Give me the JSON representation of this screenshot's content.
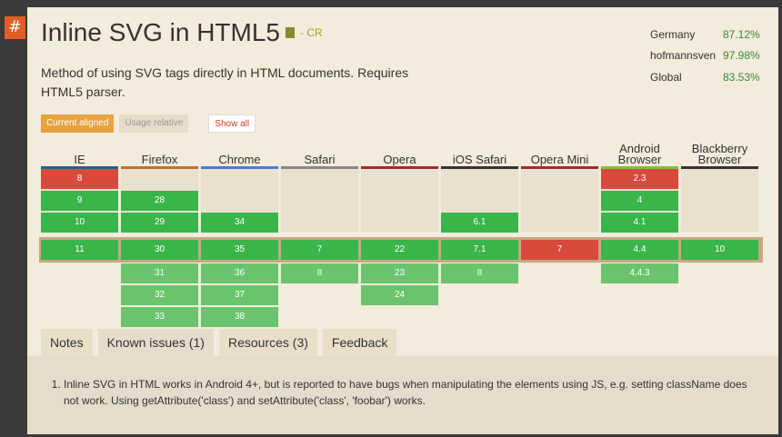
{
  "hash": "#",
  "title": "Inline SVG in HTML5",
  "status": "- CR",
  "description": "Method of using SVG tags directly in HTML documents. Requires HTML5 parser.",
  "stats": [
    {
      "name": "Germany",
      "value": "87.12%"
    },
    {
      "name": "hofmannsven",
      "value": "97.98%"
    },
    {
      "name": "Global",
      "value": "83.53%"
    }
  ],
  "modes": {
    "current": "Current aligned",
    "usage": "Usage relative",
    "show_all": "Show all"
  },
  "browsers": [
    {
      "name": "IE",
      "bar": "#2b5c8a",
      "cells": [
        {
          "v": "8",
          "s": "n"
        },
        {
          "v": "9",
          "s": "y"
        },
        {
          "v": "10",
          "s": "y"
        },
        {
          "v": "11",
          "s": "y"
        }
      ]
    },
    {
      "name": "Firefox",
      "bar": "#c0722b",
      "cells": [
        {
          "v": "28",
          "s": "y"
        },
        {
          "v": "29",
          "s": "y"
        },
        {
          "v": "30",
          "s": "y"
        },
        {
          "v": "31",
          "s": "ly"
        },
        {
          "v": "32",
          "s": "ly"
        },
        {
          "v": "33",
          "s": "ly"
        }
      ]
    },
    {
      "name": "Chrome",
      "bar": "#4c7bd0",
      "cells": [
        {
          "v": "34",
          "s": "y"
        },
        {
          "v": "35",
          "s": "y"
        },
        {
          "v": "36",
          "s": "ly"
        },
        {
          "v": "37",
          "s": "ly"
        },
        {
          "v": "38",
          "s": "ly"
        }
      ]
    },
    {
      "name": "Safari",
      "bar": "#888888",
      "cells": [
        {
          "v": "7",
          "s": "y"
        },
        {
          "v": "8",
          "s": "ly"
        }
      ]
    },
    {
      "name": "Opera",
      "bar": "#a52a2a",
      "cells": [
        {
          "v": "22",
          "s": "y"
        },
        {
          "v": "23",
          "s": "ly"
        },
        {
          "v": "24",
          "s": "ly"
        }
      ]
    },
    {
      "name": "iOS Safari",
      "bar": "#333333",
      "cells": [
        {
          "v": "6.1",
          "s": "y"
        },
        {
          "v": "7.1",
          "s": "y"
        },
        {
          "v": "8",
          "s": "ly"
        }
      ]
    },
    {
      "name": "Opera Mini",
      "bar": "#a52a2a",
      "cells": [
        {
          "v": "7",
          "s": "n"
        }
      ]
    },
    {
      "name": "Android Browser",
      "bar": "#8bbd3b",
      "cells": [
        {
          "v": "2.3",
          "s": "n"
        },
        {
          "v": "4",
          "s": "y"
        },
        {
          "v": "4.1",
          "s": "y"
        },
        {
          "v": "4.4",
          "s": "y"
        },
        {
          "v": "4.4.3",
          "s": "ly"
        }
      ]
    },
    {
      "name": "Blackberry Browser",
      "bar": "#333333",
      "cells": [
        {
          "v": "10",
          "s": "y"
        }
      ]
    }
  ],
  "tabs": [
    {
      "label": "Notes"
    },
    {
      "label": "Known issues (1)",
      "active": true
    },
    {
      "label": "Resources (3)"
    },
    {
      "label": "Feedback"
    }
  ],
  "known_issue": "Inline SVG in HTML works in Android 4+, but is reported to have bugs when manipulating the elements using JS, e.g. setting className does not work. Using getAttribute('class') and setAttribute('class', 'foobar') works."
}
